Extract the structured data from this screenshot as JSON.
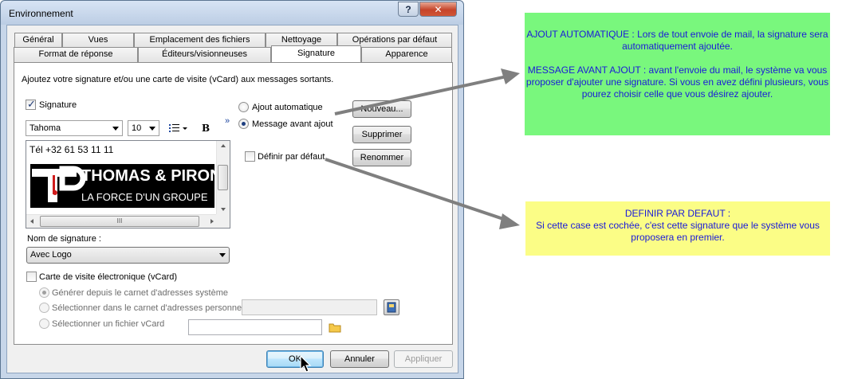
{
  "window": {
    "title": "Environnement",
    "help_label": "?",
    "close_label": "✕"
  },
  "tabs": {
    "row1": [
      "Général",
      "Vues",
      "Emplacement des fichiers",
      "Nettoyage",
      "Opérations par défaut"
    ],
    "row2": [
      "Format de réponse",
      "Éditeurs/visionneuses",
      "Signature",
      "Apparence"
    ],
    "active": "Signature"
  },
  "signature_tab": {
    "intro": "Ajoutez votre signature et/ou une carte de visite (vCard) aux messages sortants.",
    "signature_checkbox_label": "Signature",
    "signature_checked": true,
    "font_name": "Tahoma",
    "font_size": "10",
    "bold_label": "B",
    "more_label": "»",
    "editor_text": "Tél +32 61 53 11 11",
    "logo_text_main": "THOMAS & PIRON",
    "logo_text_sub": "LA FORCE D'UN GROUPE",
    "scroll_thumb_glyph": "III",
    "radio_auto_label": "Ajout automatique",
    "radio_message_label": "Message avant ajout",
    "radio_selected": "Message avant ajout",
    "btn_new": "Nouveau...",
    "btn_delete": "Supprimer",
    "btn_rename": "Renommer",
    "default_checkbox_label": "Définir par défaut",
    "default_checked": false,
    "signature_name_label": "Nom de signature :",
    "signature_name_value": "Avec Logo",
    "vcard_checkbox_label": "Carte de visite électronique (vCard)",
    "vcard_checked": false,
    "vcard_opt1": "Générer depuis le carnet d'adresses système",
    "vcard_opt2": "Sélectionner dans le carnet d'adresses personnel",
    "vcard_opt3": "Sélectionner un fichier vCard"
  },
  "footer": {
    "ok": "OK",
    "cancel": "Annuler",
    "apply": "Appliquer"
  },
  "notes": {
    "green_para1": "AJOUT AUTOMATIQUE : Lors de tout envoie de mail, la signature sera automatiquement ajoutée.",
    "green_para2": "MESSAGE AVANT AJOUT : avant l'envoie du mail, le système va vous proposer d'ajouter une signature. Si vous en avez défini plusieurs, vous pourez choisir celle que vous désirez ajouter.",
    "yellow_title": "DEFINIR PAR DEFAUT :",
    "yellow_body": "Si cette case est cochée, c'est cette signature que le système vous proposera en premier."
  },
  "colors": {
    "green_note": "#79f77d",
    "yellow_note": "#fbfd86",
    "note_text": "#1a1ad9",
    "logo_red": "#d01c1c"
  }
}
